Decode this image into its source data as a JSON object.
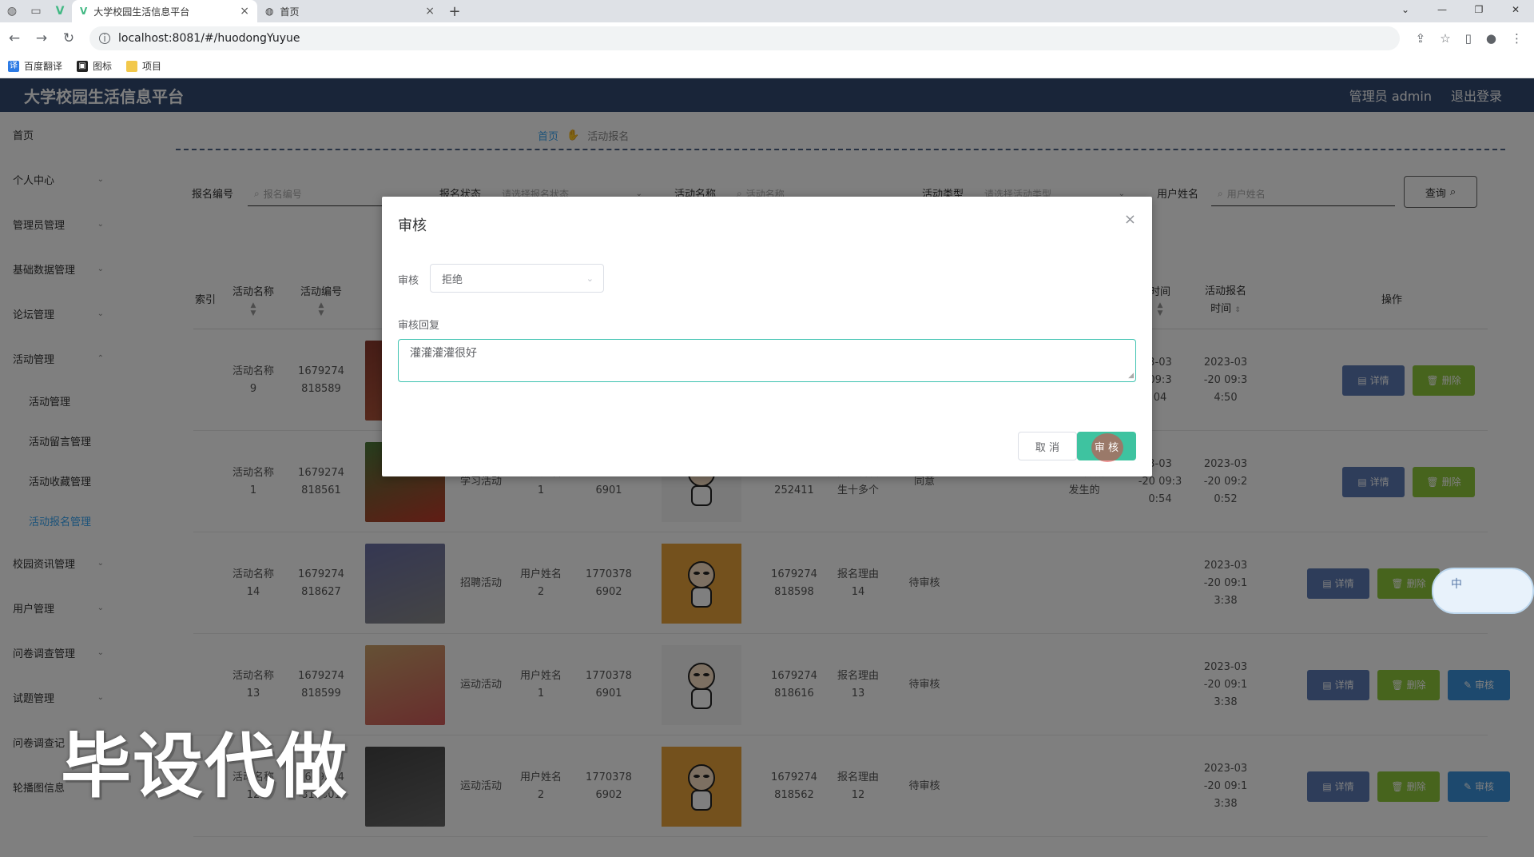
{
  "browser": {
    "tabs": [
      {
        "label": "大学校园生活信息平台",
        "active": true
      },
      {
        "label": "首页",
        "active": false
      }
    ],
    "url": "localhost:8081/#/huodongYuyue",
    "bookmarks": [
      "百度翻译",
      "图标",
      "项目"
    ]
  },
  "header": {
    "title": "大学校园生活信息平台",
    "user": "管理员 admin",
    "logout": "退出登录"
  },
  "sidebar": {
    "items": [
      {
        "label": "首页"
      },
      {
        "label": "个人中心"
      },
      {
        "label": "管理员管理"
      },
      {
        "label": "基础数据管理"
      },
      {
        "label": "论坛管理"
      },
      {
        "label": "活动管理"
      }
    ],
    "sub_items": [
      {
        "label": "活动管理"
      },
      {
        "label": "活动留言管理"
      },
      {
        "label": "活动收藏管理"
      },
      {
        "label": "活动报名管理"
      }
    ],
    "items_after": [
      {
        "label": "校园资讯管理"
      },
      {
        "label": "用户管理"
      },
      {
        "label": "问卷调查管理"
      },
      {
        "label": "试题管理"
      },
      {
        "label": "问卷调查记"
      },
      {
        "label": "轮播图信息"
      }
    ]
  },
  "breadcrumb": {
    "home": "首页",
    "current": "活动报名"
  },
  "search": {
    "fields": [
      {
        "label": "报名编号",
        "placeholder": "报名编号"
      },
      {
        "label": "报名状态",
        "placeholder": "请选择报名状态"
      },
      {
        "label": "活动名称",
        "placeholder": "活动名称"
      },
      {
        "label": "活动类型",
        "placeholder": "请选择活动类型"
      },
      {
        "label": "用户姓名",
        "placeholder": "用户姓名"
      }
    ],
    "query_label": "查询"
  },
  "table": {
    "headers": {
      "index": "索引",
      "name": "活动名称",
      "number": "活动编号",
      "time_partial": "时间",
      "reg_time_1": "活动报名",
      "reg_time_2": "时间",
      "ops": "操作"
    },
    "rows": [
      {
        "name": "活动名称\n9",
        "number": "1679274\n818589",
        "type": "",
        "user": "",
        "phone": "",
        "reg_no": "",
        "reason": "",
        "status": "",
        "reply": "",
        "audit_time": "3-03\n09:3\n04",
        "reg_time": "2023-03\n-20 09:3\n4:50",
        "has_audit": false
      },
      {
        "name": "活动名称\n1",
        "number": "1679274\n818561",
        "type": "学习活动",
        "user": "用户姓名\n1",
        "phone": "1770378\n6901",
        "reg_no": "1679275\n252411",
        "reason": "广东省发\n生十多个",
        "status": "同意",
        "reply": "绝对方所\n发生的",
        "audit_time": "3-03\n-20 09:3\n0:54",
        "reg_time": "2023-03\n-20 09:2\n0:52",
        "has_audit": false
      },
      {
        "name": "活动名称\n14",
        "number": "1679274\n818627",
        "type": "招聘活动",
        "user": "用户姓名\n2",
        "phone": "1770378\n6902",
        "reg_no": "1679274\n818598",
        "reason": "报名理由\n14",
        "status": "待审核",
        "reply": "",
        "audit_time": "",
        "reg_time": "2023-03\n-20 09:1\n3:38",
        "has_audit": true
      },
      {
        "name": "活动名称\n13",
        "number": "1679274\n818599",
        "type": "运动活动",
        "user": "用户姓名\n1",
        "phone": "1770378\n6901",
        "reg_no": "1679274\n818616",
        "reason": "报名理由\n13",
        "status": "待审核",
        "reply": "",
        "audit_time": "",
        "reg_time": "2023-03\n-20 09:1\n3:38",
        "has_audit": true
      },
      {
        "name": "活动名称\n12",
        "number": "1679274\n818601",
        "type": "运动活动",
        "user": "用户姓名\n2",
        "phone": "1770378\n6902",
        "reg_no": "1679274\n818562",
        "reason": "报名理由\n12",
        "status": "待审核",
        "reply": "",
        "audit_time": "",
        "reg_time": "2023-03\n-20 09:1\n3:38",
        "has_audit": true
      }
    ],
    "op_labels": {
      "detail": "详情",
      "delete": "删除",
      "audit": "审核"
    }
  },
  "dialog": {
    "title": "审核",
    "audit_label": "审核",
    "audit_value": "拒绝",
    "reply_label": "审核回复",
    "reply_value": "灌灌灌灌很好",
    "cancel": "取 消",
    "confirm": "审 核"
  },
  "watermark": "毕设代做",
  "ime": "中"
}
